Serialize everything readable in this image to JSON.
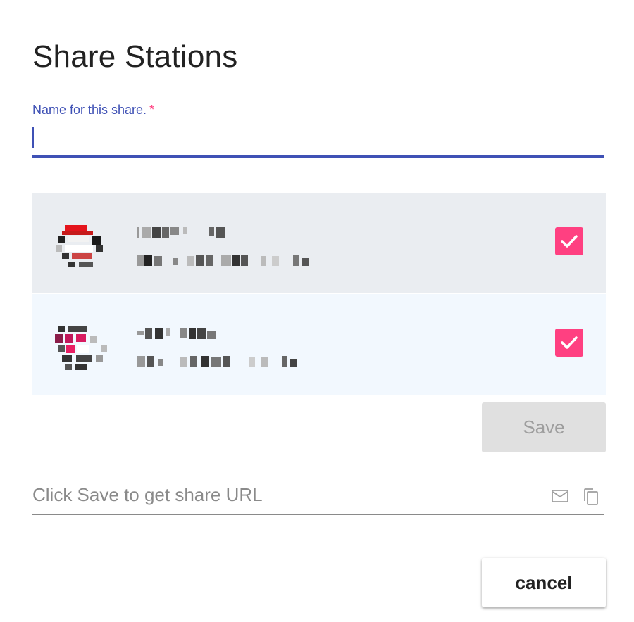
{
  "dialog": {
    "title": "Share Stations"
  },
  "name_field": {
    "label": "Name for this share.",
    "required_mark": "*",
    "value": "",
    "placeholder": ""
  },
  "stations": [
    {
      "checked": true,
      "avatar_icon": "station-avatar-icon"
    },
    {
      "checked": true,
      "avatar_icon": "station-avatar-icon"
    }
  ],
  "buttons": {
    "save_label": "Save",
    "cancel_label": "cancel"
  },
  "share_url": {
    "text": "Click Save to get share URL",
    "email_icon": "mail-icon",
    "copy_icon": "copy-icon"
  },
  "colors": {
    "accent": "#3f51b5",
    "checkbox": "#ff4081",
    "row_selected_bg": "#eaedf1",
    "row_hover_bg": "#f2f8fe"
  }
}
